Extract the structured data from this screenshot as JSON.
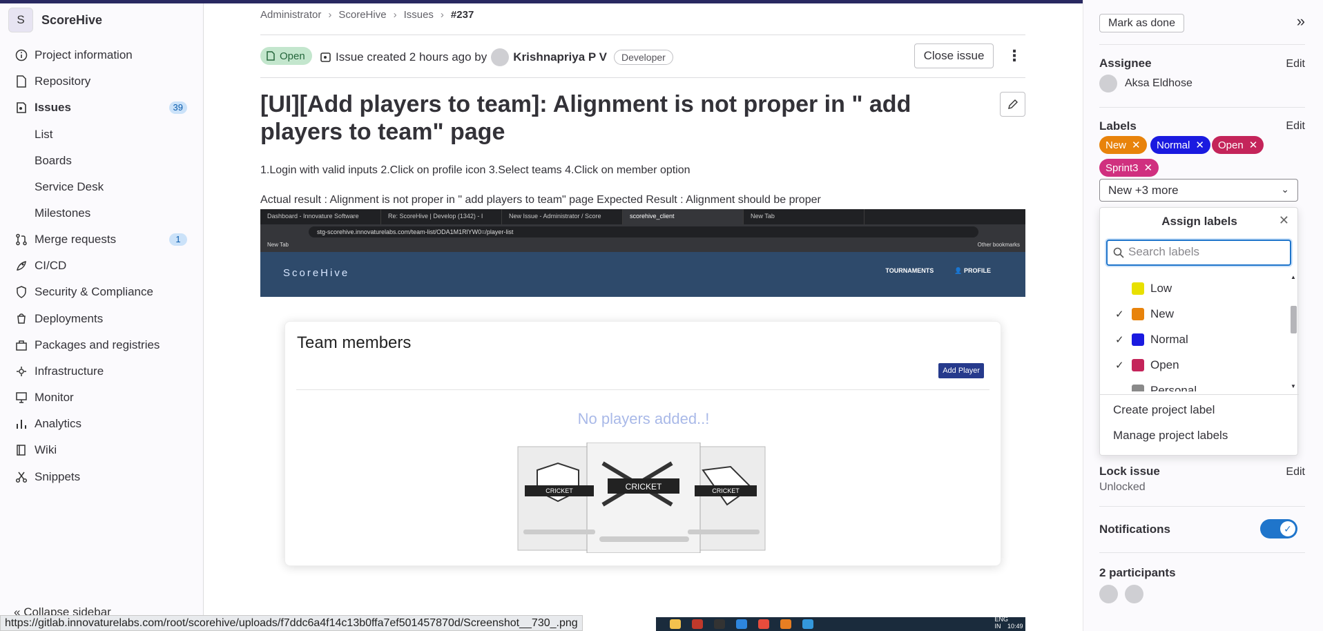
{
  "sidebar": {
    "project_initial": "S",
    "project_name": "ScoreHive",
    "items": [
      {
        "label": "Project information"
      },
      {
        "label": "Repository"
      },
      {
        "label": "Issues",
        "count": "39"
      },
      {
        "label": "List"
      },
      {
        "label": "Boards"
      },
      {
        "label": "Service Desk"
      },
      {
        "label": "Milestones"
      },
      {
        "label": "Merge requests",
        "count": "1"
      },
      {
        "label": "CI/CD"
      },
      {
        "label": "Security & Compliance"
      },
      {
        "label": "Deployments"
      },
      {
        "label": "Packages and registries"
      },
      {
        "label": "Infrastructure"
      },
      {
        "label": "Monitor"
      },
      {
        "label": "Analytics"
      },
      {
        "label": "Wiki"
      },
      {
        "label": "Snippets"
      }
    ],
    "collapse_label": "Collapse sidebar"
  },
  "breadcrumb": {
    "items": [
      "Administrator",
      "ScoreHive",
      "Issues",
      "#237"
    ]
  },
  "issue": {
    "status": "Open",
    "created_text": "Issue created 2 hours ago by",
    "author": "Krishnapriya P V",
    "author_role": "Developer",
    "close_label": "Close issue",
    "title": "[UI][Add players to team]: Alignment is not proper in \" add players to team\" page",
    "description_1": "1.Login with valid inputs 2.Click on profile icon 3.Select teams 4.Click on member option",
    "description_2": "Actual result : Alignment is not proper in \" add players to team\" page Expected Result : Alignment should be proper"
  },
  "screenshot": {
    "tabs": [
      "Dashboard - Innovature Software",
      "Re: ScoreHive | Develop (1342) - I",
      "New Issue - Administrator / Score",
      "scorehive_client",
      "New Tab"
    ],
    "url": "stg-scorehive.innovaturelabs.com/team-list/ODA1M1RlYW0=/player-list",
    "bookmark": "New Tab",
    "other_bookmarks": "Other bookmarks",
    "app_logo": "ScoreHive",
    "nav_tournaments": "TOURNAMENTS",
    "nav_profile": "PROFILE",
    "card_title": "Team members",
    "add_player": "Add Player",
    "empty_text": "No players added..!",
    "badge_text": "CRICKET",
    "tray_lang": "ENG IN",
    "tray_time": "10:49"
  },
  "right_sidebar": {
    "mark_done": "Mark as done",
    "assignee_label": "Assignee",
    "assignee_name": "Aksa Eldhose",
    "edit": "Edit",
    "labels_label": "Labels",
    "labels": [
      {
        "name": "New",
        "color": "#e8830b"
      },
      {
        "name": "Normal",
        "color": "#1a1ae0"
      },
      {
        "name": "Open",
        "color": "#c4245a"
      },
      {
        "name": "Sprint3",
        "color": "#d0307f"
      }
    ],
    "dropdown_value": "New +3 more",
    "assign_title": "Assign labels",
    "search_placeholder": "Search labels",
    "options": [
      {
        "name": "Low",
        "color": "#e8e000",
        "checked": false
      },
      {
        "name": "New",
        "color": "#e8830b",
        "checked": true
      },
      {
        "name": "Normal",
        "color": "#1a1ae0",
        "checked": true
      },
      {
        "name": "Open",
        "color": "#c4245a",
        "checked": true
      },
      {
        "name": "Personal",
        "color": "#8a8a8a",
        "checked": false
      }
    ],
    "create_label": "Create project label",
    "manage_labels": "Manage project labels",
    "lock_label": "Lock issue",
    "lock_value": "Unlocked",
    "notifications_label": "Notifications",
    "participants_label": "2 participants"
  },
  "status_url": "https://gitlab.innovaturelabs.com/root/scorehive/uploads/f7ddc6a4f14c13b0ffa7ef501457870d/Screenshot__730_.png"
}
